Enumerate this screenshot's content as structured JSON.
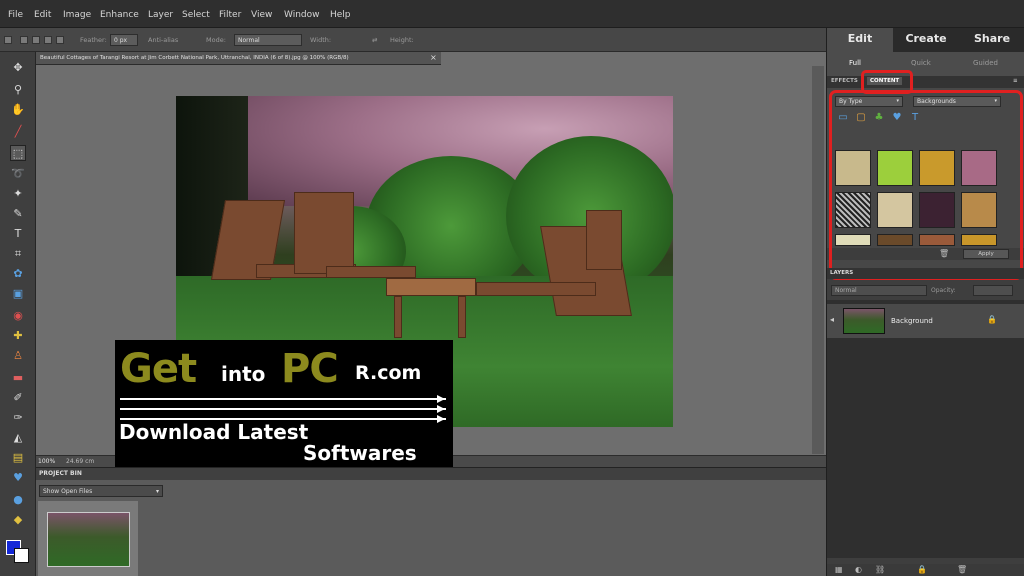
{
  "menu": {
    "items": [
      "File",
      "Edit",
      "Image",
      "Enhance",
      "Layer",
      "Select",
      "Filter",
      "View",
      "Window",
      "Help"
    ]
  },
  "options_bar": {
    "feather_label": "Feather:",
    "feather_value": "0 px",
    "anti_alias_label": "Anti-alias",
    "mode_label": "Mode:",
    "mode_value": "Normal",
    "width_label": "Width:",
    "height_label": "Height:"
  },
  "toolbox": {
    "tools": [
      "move-tool",
      "zoom-tool",
      "hand-tool",
      "eyedropper-tool",
      "rectangular-marquee-tool",
      "lasso-tool",
      "magic-wand-tool",
      "quick-selection-tool",
      "type-tool",
      "crop-tool",
      "cookie-cutter-tool",
      "straighten-tool",
      "red-eye-tool",
      "spot-healing-tool",
      "clone-stamp-tool",
      "eraser-tool",
      "brush-tool",
      "smart-brush-tool",
      "paint-bucket-tool",
      "gradient-tool",
      "custom-shape-tool",
      "blur-tool",
      "sponge-tool"
    ],
    "foreground_color": "#1428d8",
    "background_color": "#ffffff"
  },
  "document": {
    "tab_label": "Beautiful Cottages of Tarangi Resort at Jim Corbett National Park, Uttranchal, INDIA (6 of 8).jpg @ 100% (RGB/8)",
    "zoom": "100%",
    "status": "24.69 cm"
  },
  "watermark": {
    "get": "Get",
    "into": "into",
    "pc": "PC",
    "rcom": "R.com",
    "line1": "Download Latest",
    "line2": "Softwares"
  },
  "project_bin": {
    "title": "PROJECT BIN",
    "select_value": "Show Open Files"
  },
  "right_panel": {
    "mode_tabs": [
      "Edit",
      "Create",
      "Share"
    ],
    "active_mode": "Edit",
    "sub_tabs": [
      "Full",
      "Quick",
      "Guided"
    ],
    "panel_tabs": [
      "EFFECTS",
      "CONTENT"
    ],
    "active_panel": "CONTENT",
    "content_filter": "By Type",
    "content_category": "Backgrounds",
    "content_type_icons": [
      "shape-icon",
      "frame-icon",
      "graphic-icon",
      "theme-icon",
      "text-icon"
    ],
    "content_swatches": [
      "#c8b98c",
      "#9ccf3c",
      "#c99a2c",
      "#a86a86",
      "#8a8a8a",
      "#d4c6a0",
      "#3c2232",
      "#b88a4a",
      "#e0dcb8",
      "#6a4a2a",
      "#9a5a3a",
      "#c8962a"
    ],
    "apply_label": "Apply",
    "layers_title": "LAYERS",
    "blend_mode": "Normal",
    "opacity_label": "Opacity:",
    "layer_name": "Background"
  },
  "colors": {
    "highlight": "#e02020"
  }
}
